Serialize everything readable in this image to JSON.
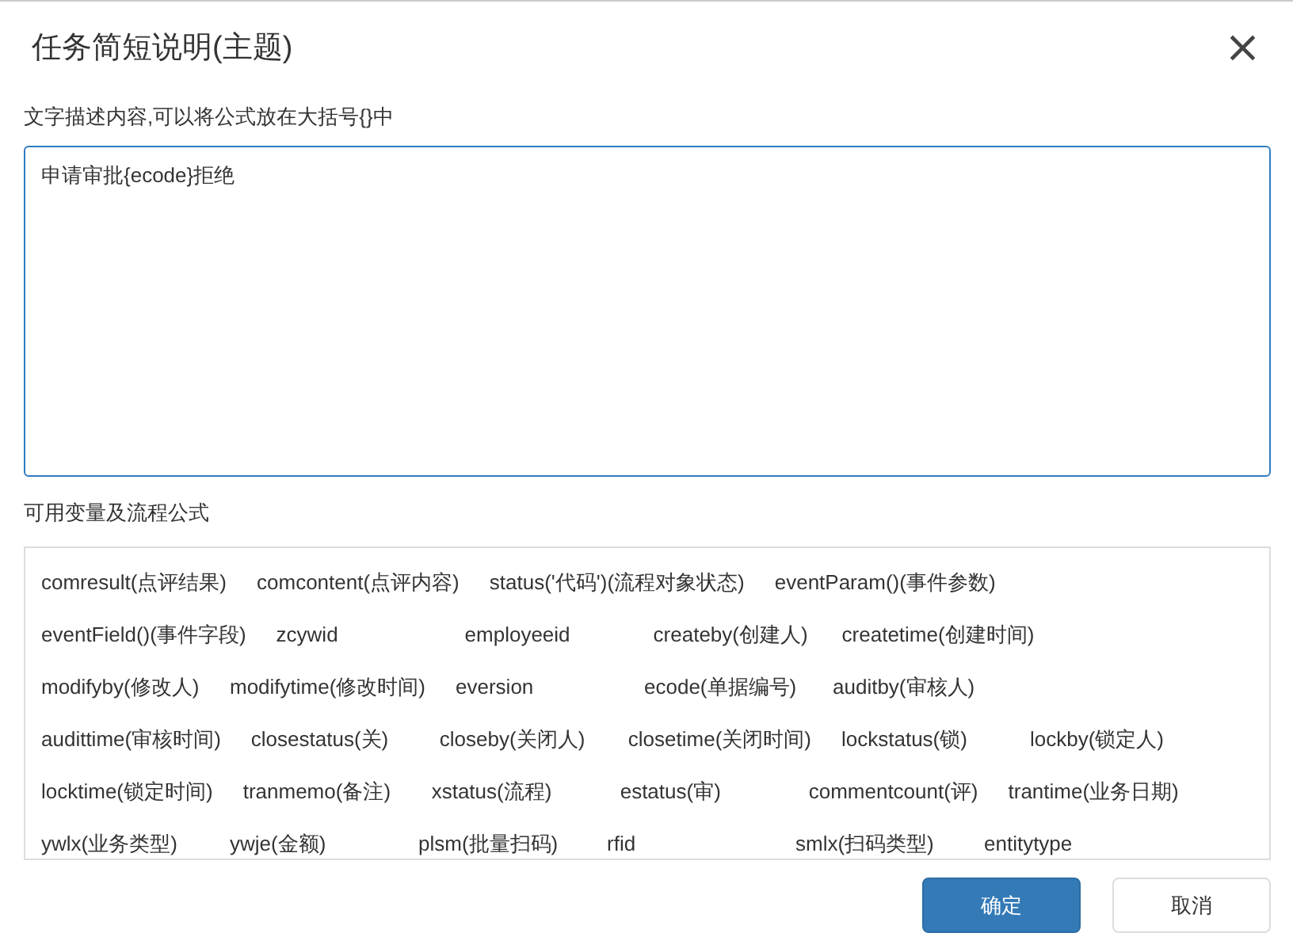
{
  "dialog": {
    "title": "任务简短说明(主题)",
    "close_icon": "×"
  },
  "description": {
    "label": "文字描述内容,可以将公式放在大括号{}中",
    "value": "申请审批{ecode}拒绝"
  },
  "variables": {
    "label": "可用变量及流程公式",
    "rows": [
      [
        "comresult(点评结果)",
        "comcontent(点评内容)",
        "status('代码')(流程对象状态)",
        "eventParam()(事件参数)"
      ],
      [
        "eventField()(事件字段)",
        "zcywid",
        "employeeid",
        "createby(创建人)",
        "createtime(创建时间)"
      ],
      [
        "modifyby(修改人)",
        "modifytime(修改时间)",
        "eversion",
        "ecode(单据编号)",
        "auditby(审核人)"
      ],
      [
        "audittime(审核时间)",
        "closestatus(关)",
        "closeby(关闭人)",
        "closetime(关闭时间)",
        "lockstatus(锁)",
        "lockby(锁定人)"
      ],
      [
        "locktime(锁定时间)",
        "tranmemo(备注)",
        "xstatus(流程)",
        "estatus(审)",
        "commentcount(评)",
        "trantime(业务日期)"
      ],
      [
        "ywlx(业务类型)",
        "ywje(金额)",
        "plsm(批量扫码)",
        "rfid",
        "smlx(扫码类型)",
        "entitytype"
      ]
    ]
  },
  "buttons": [
    {
      "label": "确定",
      "kind": "primary"
    },
    {
      "label": "取消",
      "kind": "default"
    }
  ]
}
